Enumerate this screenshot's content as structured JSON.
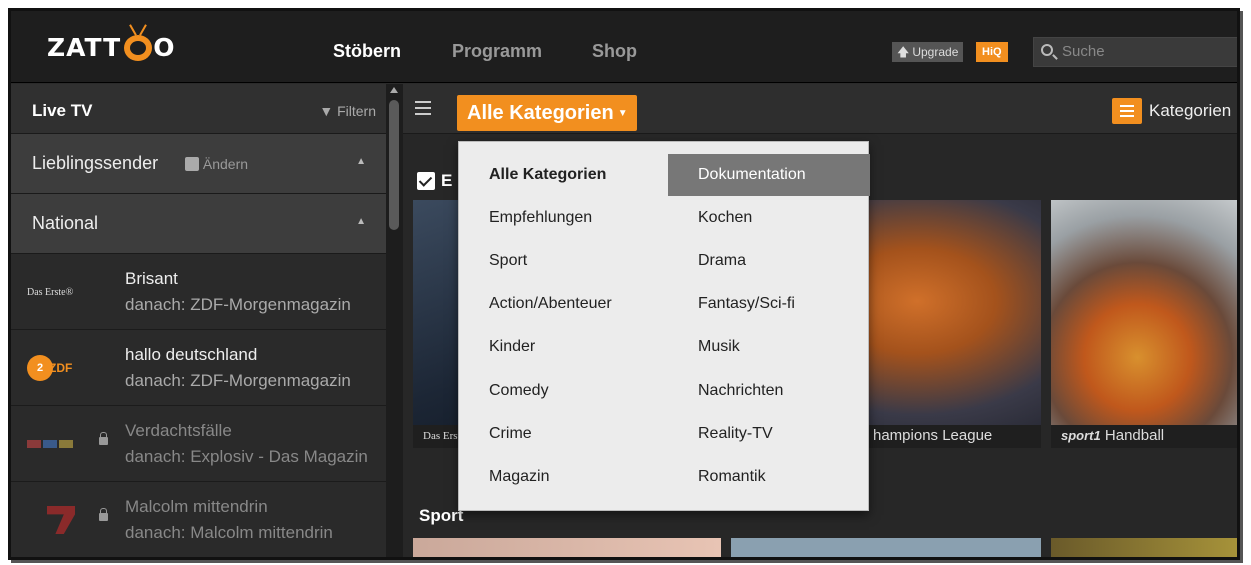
{
  "app": {
    "logo": "ZATTOO"
  },
  "nav": {
    "items": [
      "Stöbern",
      "Programm",
      "Shop"
    ],
    "active": "Stöbern"
  },
  "header": {
    "upgrade_label": "Upgrade",
    "hiq_label": "HiQ",
    "search_placeholder": "Suche"
  },
  "sidebar": {
    "title": "Live TV",
    "filter_label": "Filtern",
    "sections": {
      "favorites": "Lieblingssender",
      "edit_label": "Ändern",
      "national": "National"
    },
    "channels": [
      {
        "logo": "Das Erste®",
        "now": "Brisant",
        "next": "danach: ZDF-Morgenmagazin"
      },
      {
        "logo": "ZDF",
        "now": "hallo deutschland",
        "next": "danach: ZDF-Morgenmagazin"
      },
      {
        "logo": "RTL",
        "now": "Verdachtsfälle",
        "next": "danach: Explosiv - Das Magazin"
      },
      {
        "logo": "ProSieben",
        "now": "Malcolm mittendrin",
        "next": "danach: Malcolm mittendrin"
      }
    ]
  },
  "main": {
    "category_button": "Alle Kategorien",
    "kategorien_label": "Kategorien",
    "row1_head": "E",
    "row2_head": "Sport",
    "tiles": [
      {
        "caption": "Das Erst"
      },
      {
        "caption": "hampions League"
      },
      {
        "caption": "Handball",
        "channel": "sport1"
      }
    ]
  },
  "dropdown": {
    "col1": [
      "Alle Kategorien",
      "Empfehlungen",
      "Sport",
      "Action/Abenteuer",
      "Kinder",
      "Comedy",
      "Crime",
      "Magazin"
    ],
    "col2": [
      "Dokumentation",
      "Kochen",
      "Drama",
      "Fantasy/Sci-fi",
      "Musik",
      "Nachrichten",
      "Reality-TV",
      "Romantik"
    ],
    "selected": "Dokumentation"
  },
  "colors": {
    "accent": "#f28f1f",
    "background": "#2b2b2b",
    "dropdown_bg": "#ececec",
    "selected_bg": "#777777"
  }
}
